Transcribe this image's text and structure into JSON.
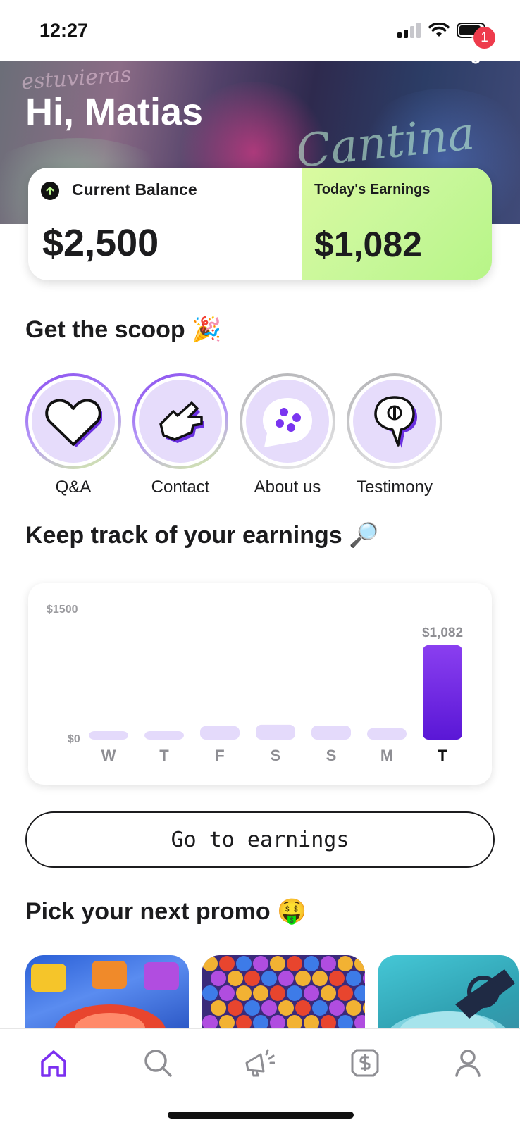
{
  "status_bar": {
    "time": "12:27"
  },
  "hero": {
    "greeting": "Hi, Matias",
    "notification_count": "1",
    "background_sign_text": "Cantina",
    "background_sign_text2": "estuvieras"
  },
  "balance": {
    "current_label": "Current Balance",
    "current_value": "$2,500",
    "today_label": "Today's Earnings",
    "today_value": "$1,082"
  },
  "scoop": {
    "title": "Get the scoop 🎉",
    "items": [
      {
        "label": "Q&A",
        "icon": "heart-icon"
      },
      {
        "label": "Contact",
        "icon": "pointing-hand-icon"
      },
      {
        "label": "About us",
        "icon": "chat-dots-icon"
      },
      {
        "label": "Testimony",
        "icon": "speech-bubble-icon"
      }
    ]
  },
  "earnings": {
    "title": "Keep track of your earnings 🔎"
  },
  "chart_data": {
    "type": "bar",
    "categories": [
      "W",
      "T",
      "F",
      "S",
      "S",
      "M",
      "T"
    ],
    "values": [
      35,
      55,
      155,
      170,
      160,
      130,
      1082
    ],
    "highlight_index": 6,
    "highlight_label": "$1,082",
    "y_tick_labels": [
      "$0",
      "$1500"
    ],
    "ylim": [
      0,
      1500
    ],
    "colors": {
      "bar": "#e4dafb",
      "highlight_top": "#8a3ff0",
      "highlight_bottom": "#5a17d6"
    }
  },
  "cta": {
    "label": "Go to earnings"
  },
  "promo": {
    "title": "Pick your next promo 🤑",
    "cards": [
      "car-game-thumbnail",
      "bubble-game-thumbnail",
      "creature-game-thumbnail"
    ]
  },
  "tabbar": {
    "items": [
      "home-icon",
      "search-icon",
      "megaphone-icon",
      "dollar-coin-icon",
      "profile-icon"
    ],
    "active_color": "#7b2ff0",
    "inactive_color": "#8e8e93"
  }
}
